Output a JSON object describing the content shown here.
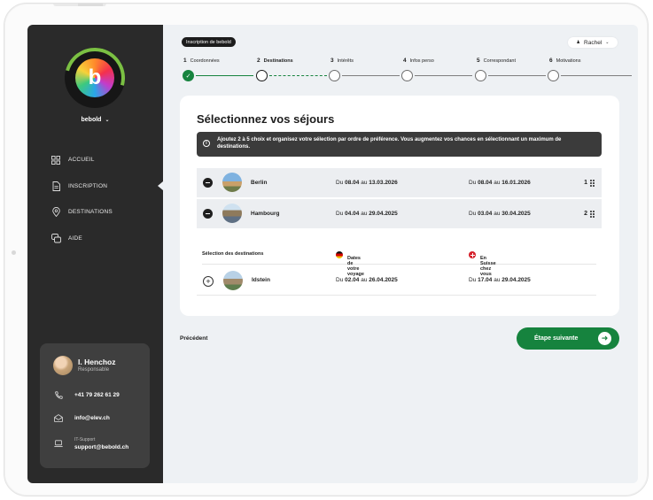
{
  "app": {
    "org_name": "bebold"
  },
  "sidebar": {
    "items": [
      {
        "label": "ACCUEIL",
        "icon": "grid-icon"
      },
      {
        "label": "INSCRIPTION",
        "icon": "document-icon",
        "active": true
      },
      {
        "label": "DESTINATIONS",
        "icon": "location-pin-icon"
      },
      {
        "label": "AIDE",
        "icon": "help-chat-icon"
      }
    ],
    "contact": {
      "name": "I. Henchoz",
      "role": "Responsable",
      "phone": "+41 79 262 61 29",
      "email": "info@elev.ch",
      "support_label": "IT-Support",
      "support_email": "support@bebold.ch"
    }
  },
  "header": {
    "badge": "Inscription de bebold",
    "user": "Rachel"
  },
  "stepper": {
    "steps": [
      {
        "num": "1",
        "label": "Coordonnées",
        "status": "done"
      },
      {
        "num": "2",
        "label": "Destinations",
        "status": "active"
      },
      {
        "num": "3",
        "label": "Intérêts",
        "status": "todo"
      },
      {
        "num": "4",
        "label": "Infos perso",
        "status": "todo"
      },
      {
        "num": "5",
        "label": "Correspondant",
        "status": "todo"
      },
      {
        "num": "6",
        "label": "Motivations",
        "status": "todo"
      }
    ]
  },
  "main": {
    "title": "Sélectionnez vos séjours",
    "info": "Ajoutez 2 à 5 choix et organisez votre sélection par ordre de préférence. Vous augmentez vos chances en sélectionnant un maximum de destinations.",
    "selected": [
      {
        "city": "Berlin",
        "d1_pre": "Du ",
        "d1_from": "08.04",
        "d1_mid": " au ",
        "d1_to": "13.03.2026",
        "d2_pre": "Du ",
        "d2_from": "08.04",
        "d2_mid": " au ",
        "d2_to": "16.01.2026",
        "rank": "1"
      },
      {
        "city": "Hambourg",
        "d1_pre": "Du ",
        "d1_from": "04.04",
        "d1_mid": " au ",
        "d1_to": "29.04.2025",
        "d2_pre": "Du ",
        "d2_from": "03.04",
        "d2_mid": " au ",
        "d2_to": "30.04.2025",
        "rank": "2"
      }
    ],
    "columns": {
      "selection": "Sélection des destinations",
      "dates": "Dates de votre voyage",
      "swiss": "En Suisse chez vous"
    },
    "available": [
      {
        "city": "Idstein",
        "d1_pre": "Du ",
        "d1_from": "02.04",
        "d1_mid": " au ",
        "d1_to": "26.04.2025",
        "d2_pre": "Du ",
        "d2_from": "17.04",
        "d2_mid": " au ",
        "d2_to": "29.04.2025"
      }
    ]
  },
  "footer": {
    "prev": "Précédent",
    "next": "Étape suivante"
  },
  "colors": {
    "accent": "#16833e",
    "sidebar": "#2a2a2a",
    "background": "#eef1f4"
  }
}
